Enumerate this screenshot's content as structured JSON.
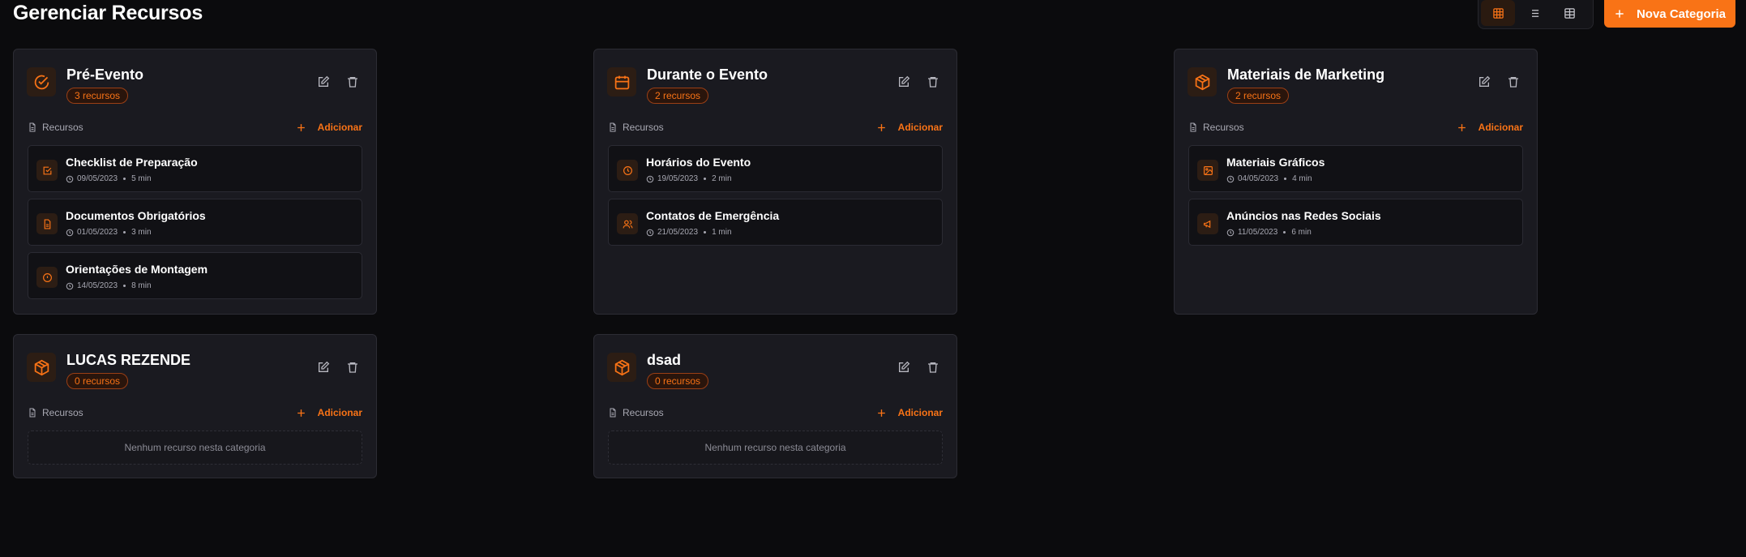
{
  "page": {
    "title": "Gerenciar Recursos"
  },
  "toolbar": {
    "new_category_label": "Nova Categoria"
  },
  "colors": {
    "accent": "#f97316",
    "background": "#0b0b0d",
    "card": "#1a1a20"
  },
  "categories": [
    {
      "name": "Pré-Evento",
      "count": "3 recursos",
      "icon": "check-circle-icon",
      "resources_label": "Recursos",
      "add_label": "Adicionar",
      "resources": [
        {
          "title": "Checklist de Preparação",
          "date": "09/05/2023",
          "duration": "5 min",
          "icon": "checkbox-icon"
        },
        {
          "title": "Documentos Obrigatórios",
          "date": "01/05/2023",
          "duration": "3 min",
          "icon": "document-icon"
        },
        {
          "title": "Orientações de Montagem",
          "date": "14/05/2023",
          "duration": "8 min",
          "icon": "info-icon"
        }
      ]
    },
    {
      "name": "Durante o Evento",
      "count": "2 recursos",
      "icon": "calendar-icon",
      "resources_label": "Recursos",
      "add_label": "Adicionar",
      "resources": [
        {
          "title": "Horários do Evento",
          "date": "19/05/2023",
          "duration": "2 min",
          "icon": "clock-icon"
        },
        {
          "title": "Contatos de Emergência",
          "date": "21/05/2023",
          "duration": "1 min",
          "icon": "users-icon"
        }
      ]
    },
    {
      "name": "Materiais de Marketing",
      "count": "2 recursos",
      "icon": "box-icon",
      "resources_label": "Recursos",
      "add_label": "Adicionar",
      "resources": [
        {
          "title": "Materiais Gráficos",
          "date": "04/05/2023",
          "duration": "4 min",
          "icon": "image-icon"
        },
        {
          "title": "Anúncios nas Redes Sociais",
          "date": "11/05/2023",
          "duration": "6 min",
          "icon": "megaphone-icon"
        }
      ]
    },
    {
      "name": "LUCAS REZENDE",
      "count": "0 recursos",
      "icon": "box-icon",
      "resources_label": "Recursos",
      "add_label": "Adicionar",
      "empty_text": "Nenhum recurso nesta categoria",
      "resources": []
    },
    {
      "name": "dsad",
      "count": "0 recursos",
      "icon": "box-icon",
      "resources_label": "Recursos",
      "add_label": "Adicionar",
      "empty_text": "Nenhum recurso nesta categoria",
      "resources": []
    }
  ]
}
